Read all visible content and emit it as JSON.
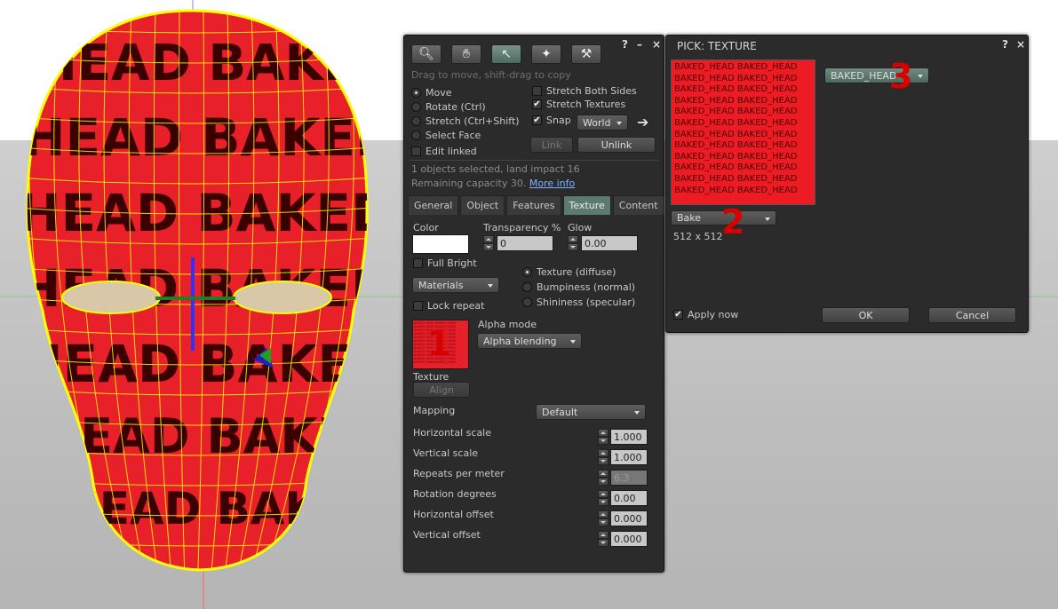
{
  "build_floater": {
    "title_controls": {
      "help": "?",
      "minimize": "–",
      "close": "×"
    },
    "tools": [
      {
        "name": "focus",
        "icon": "magnifier-icon"
      },
      {
        "name": "move",
        "icon": "hand-icon"
      },
      {
        "name": "edit",
        "icon": "arrow-cursor-icon"
      },
      {
        "name": "create",
        "icon": "magic-wand-icon"
      },
      {
        "name": "land",
        "icon": "bulldozer-icon"
      }
    ],
    "hint": "Drag to move, shift-drag to copy",
    "modes": [
      {
        "label": "Move",
        "selected": true
      },
      {
        "label": "Rotate (Ctrl)",
        "selected": false
      },
      {
        "label": "Stretch (Ctrl+Shift)",
        "selected": false
      },
      {
        "label": "Select Face",
        "selected": false
      }
    ],
    "edit_linked": {
      "label": "Edit linked",
      "checked": false
    },
    "stretch_both_sides": {
      "label": "Stretch Both Sides",
      "checked": false
    },
    "stretch_textures": {
      "label": "Stretch Textures",
      "checked": true
    },
    "snap": {
      "label": "Snap",
      "checked": true,
      "value": "World"
    },
    "link_label": "Link",
    "unlink_label": "Unlink",
    "selection_info": "1 objects selected, land impact 16",
    "remaining": "Remaining capacity 30.",
    "more_info": "More info",
    "tabs": [
      {
        "label": "General",
        "active": false
      },
      {
        "label": "Object",
        "active": false
      },
      {
        "label": "Features",
        "active": false
      },
      {
        "label": "Texture",
        "active": true
      },
      {
        "label": "Content",
        "active": false
      }
    ],
    "texture_tab": {
      "color_label": "Color",
      "transparency_label": "Transparency %",
      "transparency_value": "0",
      "glow_label": "Glow",
      "glow_value": "0.00",
      "full_bright": {
        "label": "Full Bright",
        "checked": false
      },
      "materials_value": "Materials",
      "lock_repeat": {
        "label": "Lock repeat",
        "checked": false
      },
      "material_types": [
        {
          "label": "Texture (diffuse)",
          "selected": true
        },
        {
          "label": "Bumpiness (normal)",
          "selected": false
        },
        {
          "label": "Shininess (specular)",
          "selected": false
        }
      ],
      "alpha_mode_label": "Alpha mode",
      "alpha_mode_value": "Alpha blending",
      "texture_label": "Texture",
      "align_label": "Align",
      "mapping_label": "Mapping",
      "mapping_value": "Default",
      "params": [
        {
          "label": "Horizontal scale",
          "value": "1.000",
          "disabled": false
        },
        {
          "label": "Vertical scale",
          "value": "1.000",
          "disabled": false
        },
        {
          "label": "Repeats per meter",
          "value": "6.3",
          "disabled": true
        },
        {
          "label": "Rotation degrees",
          "value": "0.00",
          "disabled": false
        },
        {
          "label": "Horizontal offset",
          "value": "0.000",
          "disabled": false
        },
        {
          "label": "Vertical offset",
          "value": "0.000",
          "disabled": false
        }
      ]
    }
  },
  "picker": {
    "title": "PICK: TEXTURE",
    "title_controls": {
      "help": "?",
      "close": "×"
    },
    "preview_line": "BAKED_HEAD BAKED_HEAD",
    "preview_line_count": 12,
    "source_value": "Bake",
    "dimensions": "512 x 512",
    "bake_select_value": "BAKED_HEAD",
    "apply_now": {
      "label": "Apply now",
      "checked": true
    },
    "ok_label": "OK",
    "cancel_label": "Cancel"
  },
  "annotations": {
    "one": "1",
    "two": "2",
    "three": "3"
  },
  "viewport": {
    "head_color": "#e8202a",
    "wireframe_color": "#ffff00",
    "head_text": [
      "HEAD BAKED",
      "HEAD BAKED",
      "HEAD BAKED",
      "HEAD BAKED",
      "HEAD BAKED",
      "HEAD BAKED",
      "HEAD BAKED"
    ]
  }
}
